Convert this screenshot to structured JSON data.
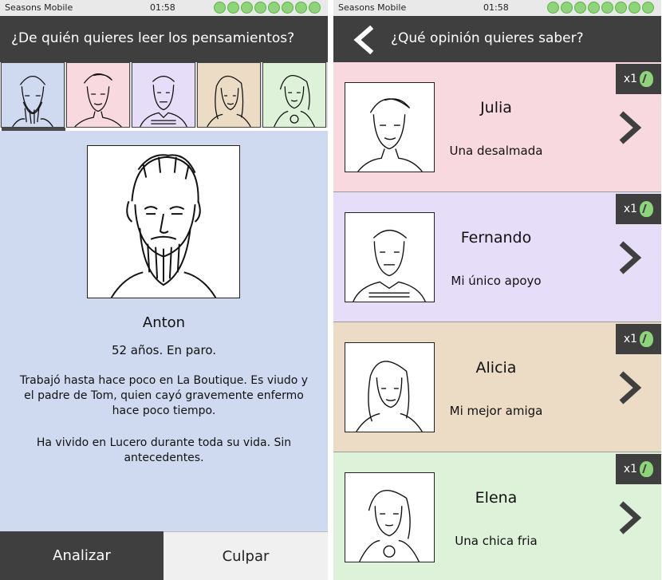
{
  "left": {
    "status": {
      "carrier": "Seasons Mobile",
      "time": "01:58",
      "battery_icons": 8
    },
    "header": {
      "title": "¿De quién quieres leer los pensamientos?"
    },
    "thumbnails": [
      {
        "name": "Anton",
        "bg": "#cfd9f0",
        "selected": true
      },
      {
        "name": "Julia",
        "bg": "#f8d9e0"
      },
      {
        "name": "Fernando",
        "bg": "#e6ddf8"
      },
      {
        "name": "Alicia",
        "bg": "#ecdcc6"
      },
      {
        "name": "Elena",
        "bg": "#ddf2d9"
      }
    ],
    "profile": {
      "name": "Anton",
      "age_status": "52 años. En paro.",
      "bio": "Trabajó hasta hace poco en La Boutique. Es viudo y el padre de Tom, quien cayó gravemente enfermo hace poco tiempo.",
      "life": "Ha vivido en Lucero durante toda su vida. Sin antecedentes."
    },
    "buttons": {
      "analyze": "Analizar",
      "blame": "Culpar"
    }
  },
  "right": {
    "status": {
      "carrier": "Seasons Mobile",
      "time": "01:58",
      "battery_icons": 8
    },
    "header": {
      "title": "¿Qué opinión quieres saber?"
    },
    "cards": [
      {
        "name": "Julia",
        "opinion": "Una desalmada",
        "cost": "x1",
        "bg": "#f8d9e0"
      },
      {
        "name": "Fernando",
        "opinion": "Mi único apoyo",
        "cost": "x1",
        "bg": "#e6ddf8"
      },
      {
        "name": "Alicia",
        "opinion": "Mi mejor amiga",
        "cost": "x1",
        "bg": "#ecdcc6"
      },
      {
        "name": "Elena",
        "opinion": "Una chica fria",
        "cost": "x1",
        "bg": "#ddf2d9"
      }
    ]
  },
  "colors": {
    "header": "#3f3f3f",
    "accent_green": "#8ed47a",
    "panel_blue": "#cfd9f0"
  }
}
